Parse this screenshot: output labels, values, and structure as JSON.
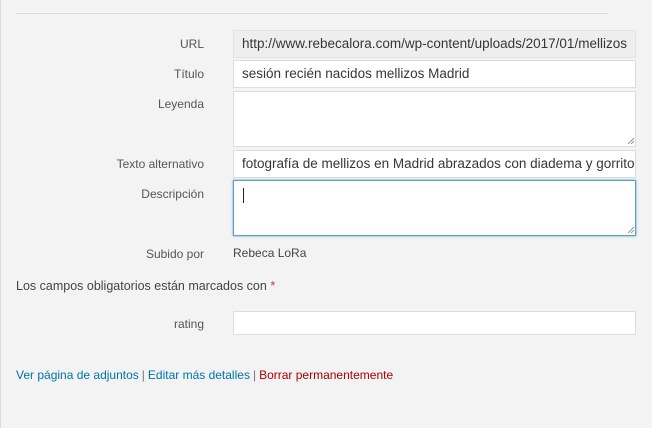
{
  "fields": {
    "url": {
      "label": "URL",
      "value": "http://www.rebecalora.com/wp-content/uploads/2017/01/mellizos"
    },
    "title": {
      "label": "Título",
      "value": "sesión recién nacidos mellizos Madrid"
    },
    "caption": {
      "label": "Leyenda",
      "value": ""
    },
    "alt": {
      "label": "Texto alternativo",
      "value": "fotografía de mellizos en Madrid abrazados con diadema y gorrito"
    },
    "description": {
      "label": "Descripción",
      "value": ""
    },
    "uploaded_by": {
      "label": "Subido por",
      "value": "Rebeca LoRa"
    },
    "rating": {
      "label": "rating",
      "value": ""
    }
  },
  "required_note": {
    "text": "Los campos obligatorios están marcados con",
    "marker": "*"
  },
  "actions": {
    "view_attachment": "Ver página de adjuntos",
    "edit_details": "Editar más detalles",
    "delete_permanently": "Borrar permanentemente",
    "separator": "|"
  },
  "colors": {
    "link": "#0073aa",
    "danger": "#a00000",
    "required": "#dc3232",
    "focus": "#5b9dd9"
  }
}
